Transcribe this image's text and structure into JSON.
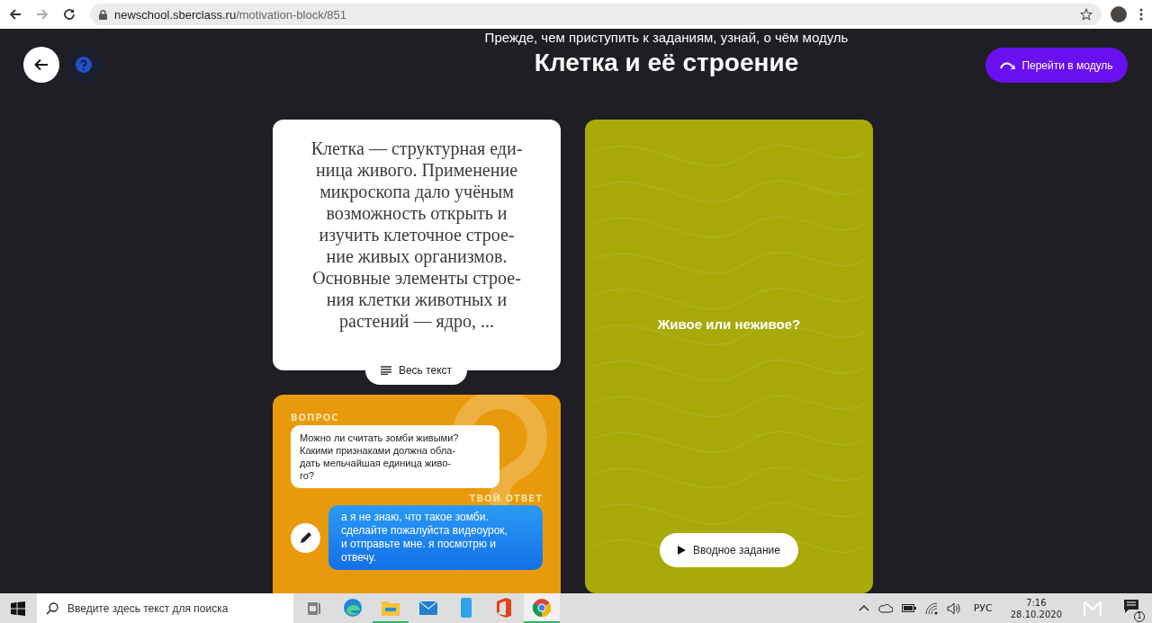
{
  "browser": {
    "url_host": "newschool.sberclass.ru",
    "url_path": "/motivation-block/851",
    "forward_disabled": true
  },
  "header": {
    "subtitle": "Прежде, чем приступить к заданиям, узнай, о чём модуль",
    "title": "Клетка и её строение",
    "module_button": "Перейти в модуль"
  },
  "text_card": {
    "lines": [
      "Клетка — структурная еди-",
      "ница живого. Применение",
      "микроскопа дало учёным",
      "возможность открыть и",
      "изучить клеточное строе-",
      "ние живых организмов.",
      "Основные элементы строе-",
      "ния клетки животных и",
      "растений — ядро, ..."
    ],
    "full_text_button": "Весь текст"
  },
  "question_card": {
    "question_label": "ВОПРОС",
    "question_lines": [
      "Можно ли считать зомби живыми?",
      "Какими признаками должна обла-",
      "дать мельчайшая единица живо-",
      "го?"
    ],
    "answer_label": "ТВОЙ ОТВЕТ",
    "answer_lines": [
      "а я не знаю, что такое зомби.",
      "сделайте пожалуйста видеоурок,",
      "и отправьте мне. я посмотрю и",
      "отвечу."
    ]
  },
  "task_card": {
    "title": "Живое или неживое?",
    "intro_button": "Вводное задание"
  },
  "taskbar": {
    "search_placeholder": "Введите здесь текст для поиска",
    "apps": [
      {
        "kind": "edge",
        "running": false,
        "selected": false
      },
      {
        "kind": "files",
        "running": true,
        "selected": false
      },
      {
        "kind": "mail",
        "running": false,
        "selected": false
      },
      {
        "kind": "phone",
        "running": false,
        "selected": false
      },
      {
        "kind": "office",
        "running": false,
        "selected": false
      },
      {
        "kind": "chrome",
        "running": true,
        "selected": true
      }
    ],
    "language": "РУС",
    "time": "7:16",
    "date": "28.10.2020",
    "notification_count": "1"
  }
}
